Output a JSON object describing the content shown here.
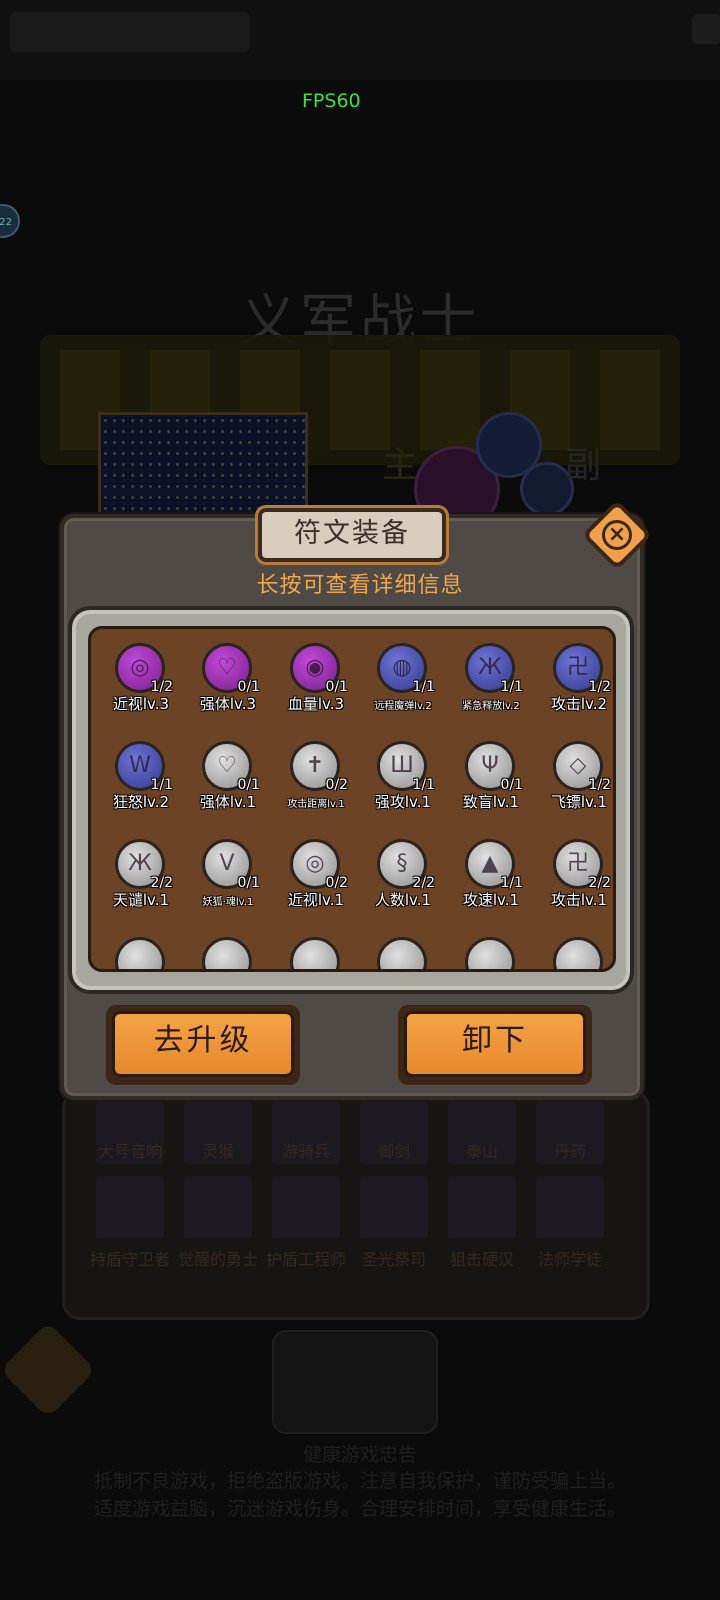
{
  "status": {
    "fps": "FPS60",
    "left_badge": "22"
  },
  "background": {
    "hero_name": "义军战士",
    "main_label": "主",
    "vice_label": "副",
    "roster_row1": [
      "大号音响",
      "灵猴",
      "游骑兵",
      "御剑",
      "泰山",
      "丹药"
    ],
    "roster_row2": [
      "持盾守卫者",
      "觉醒的勇士",
      "护盾工程师",
      "圣光祭司",
      "狙击硬汉",
      "法师学徒"
    ],
    "notice_lines": [
      "健康游戏忠告",
      "抵制不良游戏，拒绝盗版游戏。注意自我保护，谨防受骗上当。",
      "适度游戏益脑，沉迷游戏伤身。合理安排时间，享受健康生活。"
    ]
  },
  "modal": {
    "title": "符文装备",
    "close_icon": "close-icon",
    "hint": "长按可查看详细信息",
    "runes": [
      {
        "name": "近视lv.3",
        "count": "1/2",
        "color": "purple",
        "glyph": "◎"
      },
      {
        "name": "强体lv.3",
        "count": "0/1",
        "color": "purple",
        "glyph": "♡"
      },
      {
        "name": "血量lv.3",
        "count": "0/1",
        "color": "purple",
        "glyph": "◉"
      },
      {
        "name": "远程魔弹lv.2",
        "count": "1/1",
        "color": "blue",
        "glyph": "◍",
        "small": true
      },
      {
        "name": "紧急释放lv.2",
        "count": "1/1",
        "color": "blue",
        "glyph": "Ж",
        "small": true
      },
      {
        "name": "攻击lv.2",
        "count": "1/2",
        "color": "blue",
        "glyph": "卍"
      },
      {
        "name": "狂怒lv.2",
        "count": "1/1",
        "color": "blue",
        "glyph": "W"
      },
      {
        "name": "强体lv.1",
        "count": "0/1",
        "color": "gray",
        "glyph": "♡"
      },
      {
        "name": "攻击距离lv.1",
        "count": "0/2",
        "color": "gray",
        "glyph": "✝",
        "small": true
      },
      {
        "name": "强攻lv.1",
        "count": "1/1",
        "color": "gray",
        "glyph": "Ш"
      },
      {
        "name": "致盲lv.1",
        "count": "0/1",
        "color": "gray",
        "glyph": "Ψ"
      },
      {
        "name": "飞镖lv.1",
        "count": "1/2",
        "color": "gray",
        "glyph": "◇"
      },
      {
        "name": "天谴lv.1",
        "count": "2/2",
        "color": "gray",
        "glyph": "Ж"
      },
      {
        "name": "妖狐·魂lv.1",
        "count": "0/1",
        "color": "gray",
        "glyph": "V",
        "small": true
      },
      {
        "name": "近视lv.1",
        "count": "0/2",
        "color": "gray",
        "glyph": "◎"
      },
      {
        "name": "人数lv.1",
        "count": "2/2",
        "color": "gray",
        "glyph": "§"
      },
      {
        "name": "攻速lv.1",
        "count": "1/1",
        "color": "gray",
        "glyph": "▲"
      },
      {
        "name": "攻击lv.1",
        "count": "2/2",
        "color": "gray",
        "glyph": "卍"
      },
      {
        "name": "",
        "count": "",
        "color": "gray",
        "glyph": ""
      },
      {
        "name": "",
        "count": "",
        "color": "gray",
        "glyph": ""
      },
      {
        "name": "",
        "count": "",
        "color": "gray",
        "glyph": ""
      },
      {
        "name": "",
        "count": "",
        "color": "gray",
        "glyph": ""
      },
      {
        "name": "",
        "count": "",
        "color": "gray",
        "glyph": ""
      },
      {
        "name": "",
        "count": "",
        "color": "gray",
        "glyph": ""
      }
    ],
    "upgrade_label": "去升级",
    "unequip_label": "卸下"
  }
}
